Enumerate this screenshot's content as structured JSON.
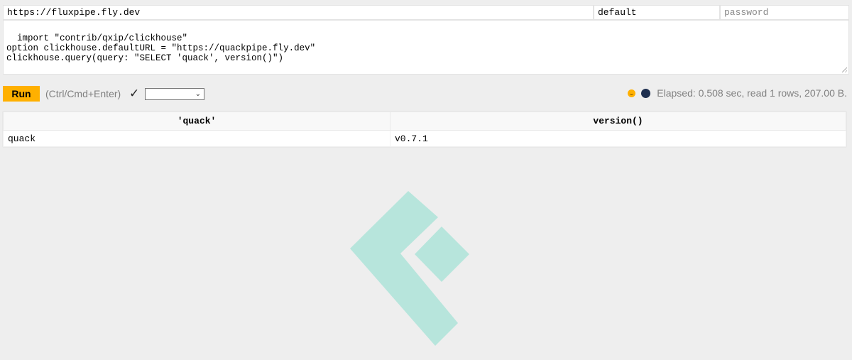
{
  "connection": {
    "url": "https://fluxpipe.fly.dev",
    "user": "default",
    "password_placeholder": "password"
  },
  "query_text": "import \"contrib/qxip/clickhouse\"\noption clickhouse.defaultURL = \"https://quackpipe.fly.dev\"\nclickhouse.query(query: \"SELECT 'quack', version()\")",
  "toolbar": {
    "run_label": "Run",
    "shortcut_hint": "(Ctrl/Cmd+Enter)",
    "check_glyph": "✓",
    "format_selected": ""
  },
  "status": {
    "elapsed_text": "Elapsed: 0.508 sec, read 1 rows, 207.00 B."
  },
  "icons": {
    "status": "smile-icon",
    "theme": "theme-toggle-icon",
    "logo": "logo-icon"
  },
  "colors": {
    "accent": "#ffb000",
    "logo": "#b7e5dc",
    "background": "#eeeeee",
    "theme_toggle": "#1f3050"
  },
  "results": {
    "columns": [
      "'quack'",
      "version()"
    ],
    "rows": [
      [
        "quack",
        "v0.7.1"
      ]
    ]
  }
}
